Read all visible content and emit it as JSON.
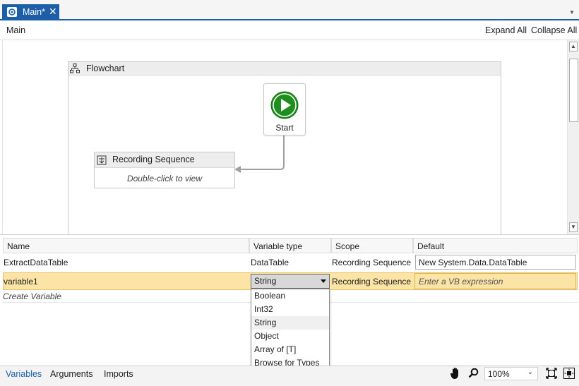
{
  "document_tab": {
    "label": "Main*",
    "close_glyph": "✕"
  },
  "breadcrumb": "Main",
  "toolbar": {
    "expand_all": "Expand All",
    "collapse_all": "Collapse All"
  },
  "flowchart": {
    "title": "Flowchart",
    "start_label": "Start",
    "sequence": {
      "title": "Recording Sequence",
      "hint": "Double-click to view"
    }
  },
  "variables_table": {
    "headers": [
      "Name",
      "Variable type",
      "Scope",
      "Default"
    ],
    "rows": [
      {
        "name": "ExtractDataTable",
        "type": "DataTable",
        "scope": "Recording Sequence",
        "default": "New System.Data.DataTable"
      },
      {
        "name": "variable1",
        "type": "String",
        "scope": "Recording Sequence",
        "default_placeholder": "Enter a VB expression"
      }
    ],
    "create_label": "Create Variable"
  },
  "type_dropdown": {
    "selected": "String",
    "options": [
      "Boolean",
      "Int32",
      "String",
      "Object",
      "Array of [T]",
      "Browse for Types ..."
    ]
  },
  "bottom_tabs": [
    "Variables",
    "Arguments",
    "Imports"
  ],
  "zoom": {
    "level": "100%"
  },
  "icons": {
    "tab": "workflow-icon",
    "flowchart": "flowchart-icon",
    "start": "play-icon",
    "sequence": "sequence-icon",
    "pan": "hand-icon",
    "zoom": "magnifier-icon",
    "fit": "fit-to-screen-icon",
    "overview": "overview-icon"
  },
  "colors": {
    "accent": "#1c5fa8",
    "start_green": "#1e8e1e",
    "selected_row": "#fce4a6"
  }
}
